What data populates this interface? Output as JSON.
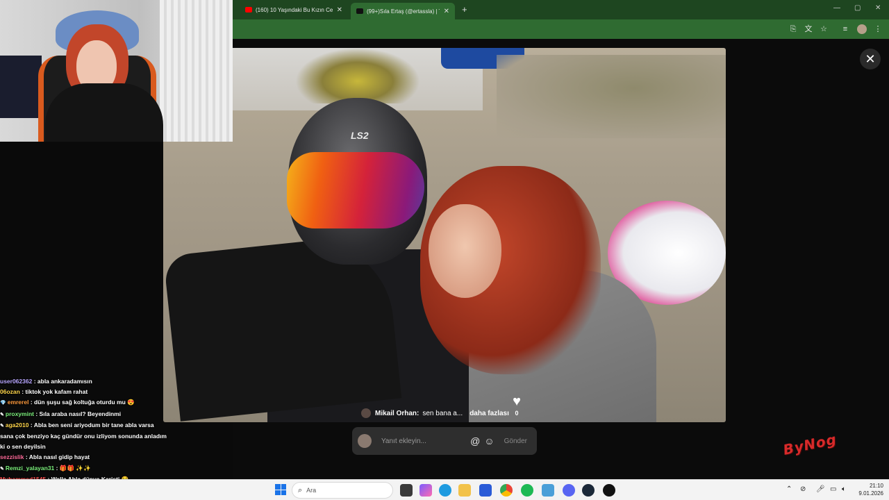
{
  "browser": {
    "tabs": [
      {
        "title": "(160) 10 Yaşındaki Bu Kızın Ces",
        "icon": "youtube-icon",
        "color": "#ff0000"
      },
      {
        "title": "(99+)Sıla Ertaş (@ertassla) | Tik",
        "icon": "tiktok-icon",
        "color": "#111111"
      }
    ],
    "new_tab": "+"
  },
  "post": {
    "comment_author": "Mikail Orhan:",
    "comment_text": "sen bana a...",
    "comment_more": "daha fazlası",
    "like_count": "0",
    "reply_placeholder": "Yanıt ekleyin...",
    "send_label": "Gönder"
  },
  "chat": [
    {
      "user": "user062362",
      "color": "#b8a6ff",
      "text": ": abla ankaradamısın"
    },
    {
      "user": "06ozan",
      "color": "#ffd54a",
      "text": ": tiktok yok kafam rahat"
    },
    {
      "user": "emrerel",
      "color": "#ff9a3c",
      "text": ": dün şuşu sağ koltuğa oturdu mu 😍"
    },
    {
      "user": "proxymint",
      "color": "#7cf07c",
      "text": ": Sıla araba nasıl? Beyendinmi"
    },
    {
      "user": "aga2010",
      "color": "#ffd54a",
      "text": ": Abla ben seni ariyodum bir tane abla varsa sana çok benziyo kaç gündür onu izliyom sonunda anladım ki o sen deyilsin"
    },
    {
      "user": "sezzislik",
      "color": "#ff6b9a",
      "text": ": Abla nasıl gidip hayat"
    },
    {
      "user": "Remzi_yalayan31",
      "color": "#7cf07c",
      "text": ": 🎁🎁 ✨✨"
    },
    {
      "user": "Muhammed1545",
      "color": "#ff4f4f",
      "text": ": Walla Abla dünya Karişti 😂"
    }
  ],
  "brand": "ByNog",
  "taskbar": {
    "search_placeholder": "Ara",
    "time": "21:10",
    "date": "9.01.2026"
  }
}
